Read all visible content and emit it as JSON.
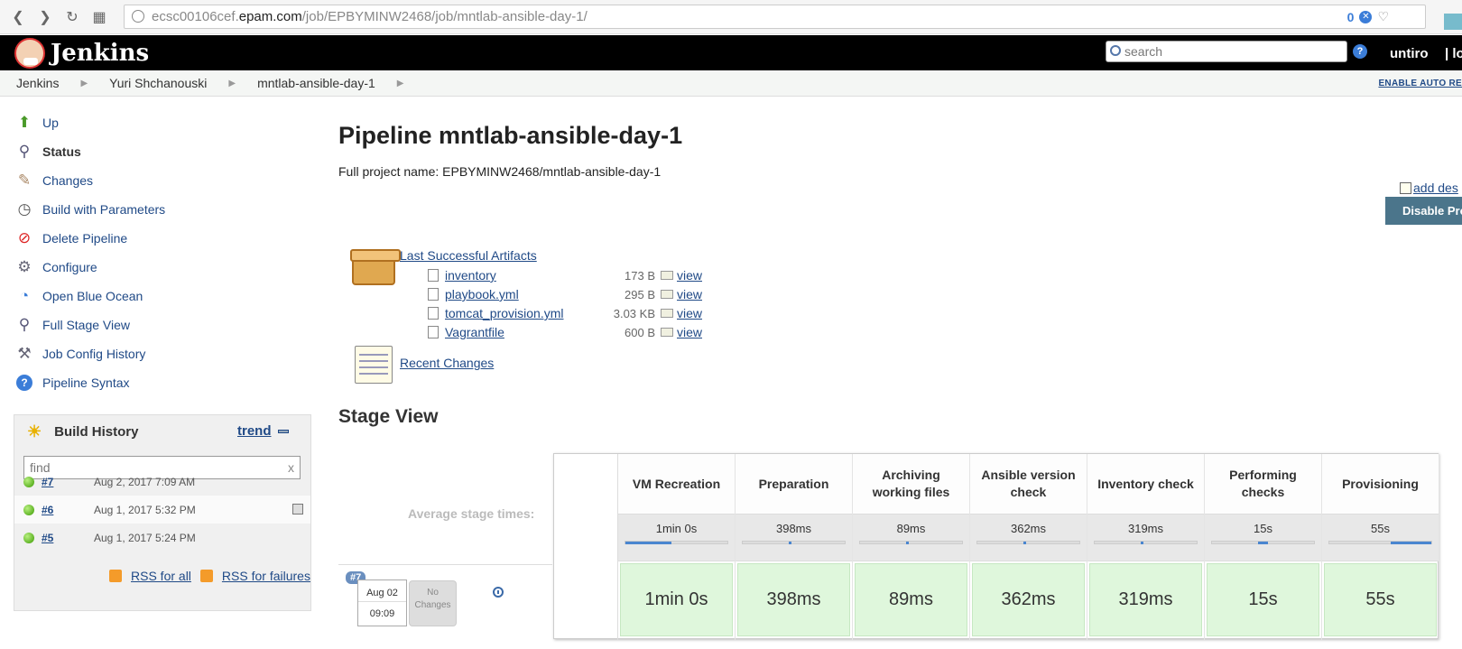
{
  "browser": {
    "url_prefix": "ecsc00106cef.",
    "url_host": "epam.com",
    "url_path": "/job/EPBYMINW2468/job/mntlab-ansible-day-1/"
  },
  "header": {
    "brand": "Jenkins",
    "search_placeholder": "search",
    "user": "untiro",
    "logout": "| lo"
  },
  "breadcrumbs": [
    "Jenkins",
    "Yuri Shchanouski",
    "mntlab-ansible-day-1"
  ],
  "auto_refresh": "ENABLE AUTO RE",
  "sidebar": {
    "items": [
      {
        "label": "Up",
        "icon": "up-arrow-icon"
      },
      {
        "label": "Status",
        "icon": "magnifier-icon"
      },
      {
        "label": "Changes",
        "icon": "notepad-icon"
      },
      {
        "label": "Build with Parameters",
        "icon": "clock-icon"
      },
      {
        "label": "Delete Pipeline",
        "icon": "no-entry-icon"
      },
      {
        "label": "Configure",
        "icon": "gear-icon"
      },
      {
        "label": "Open Blue Ocean",
        "icon": "blue-ocean-icon"
      },
      {
        "label": "Full Stage View",
        "icon": "magnifier-icon"
      },
      {
        "label": "Job Config History",
        "icon": "tools-icon"
      },
      {
        "label": "Pipeline Syntax",
        "icon": "help-icon"
      }
    ]
  },
  "build_history": {
    "title": "Build History",
    "trend": "trend",
    "find_placeholder": "find",
    "builds": [
      {
        "num": "#7",
        "date": "Aug 2, 2017 7:09 AM"
      },
      {
        "num": "#6",
        "date": "Aug 1, 2017 5:32 PM"
      },
      {
        "num": "#5",
        "date": "Aug 1, 2017 5:24 PM"
      }
    ],
    "rss_all": "RSS for all",
    "rss_failures": "RSS for failures"
  },
  "main": {
    "title": "Pipeline mntlab-ansible-day-1",
    "full_name": "Full project name: EPBYMINW2468/mntlab-ansible-day-1",
    "add_description": "add des",
    "disable": "Disable Pro",
    "artifacts_title": "Last Successful Artifacts",
    "artifacts": [
      {
        "name": "inventory",
        "size": "173 B",
        "view": "view"
      },
      {
        "name": "playbook.yml",
        "size": "295 B",
        "view": "view"
      },
      {
        "name": "tomcat_provision.yml",
        "size": "3.03 KB",
        "view": "view"
      },
      {
        "name": "Vagrantfile",
        "size": "600 B",
        "view": "view"
      }
    ],
    "recent_changes": "Recent Changes"
  },
  "stage_view": {
    "title": "Stage View",
    "avg_label": "Average stage times:",
    "run": {
      "tag": "#7",
      "date": "Aug 02",
      "time": "09:09",
      "changes": "No Changes"
    },
    "stages": [
      {
        "name": "VM Recreation",
        "avg": "1min 0s",
        "avg_fraction": 0.45,
        "run": "1min 0s"
      },
      {
        "name": "Preparation",
        "avg": "398ms",
        "avg_fraction": 0.01,
        "run": "398ms"
      },
      {
        "name": "Archiving working files",
        "avg": "89ms",
        "avg_fraction": 0.01,
        "run": "89ms"
      },
      {
        "name": "Ansible version check",
        "avg": "362ms",
        "avg_fraction": 0.01,
        "run": "362ms"
      },
      {
        "name": "Inventory check",
        "avg": "319ms",
        "avg_fraction": 0.01,
        "run": "319ms"
      },
      {
        "name": "Performing checks",
        "avg": "15s",
        "avg_fraction": 0.1,
        "run": "15s"
      },
      {
        "name": "Provisioning",
        "avg": "55s",
        "avg_fraction": 0.4,
        "run": "55s"
      }
    ]
  }
}
